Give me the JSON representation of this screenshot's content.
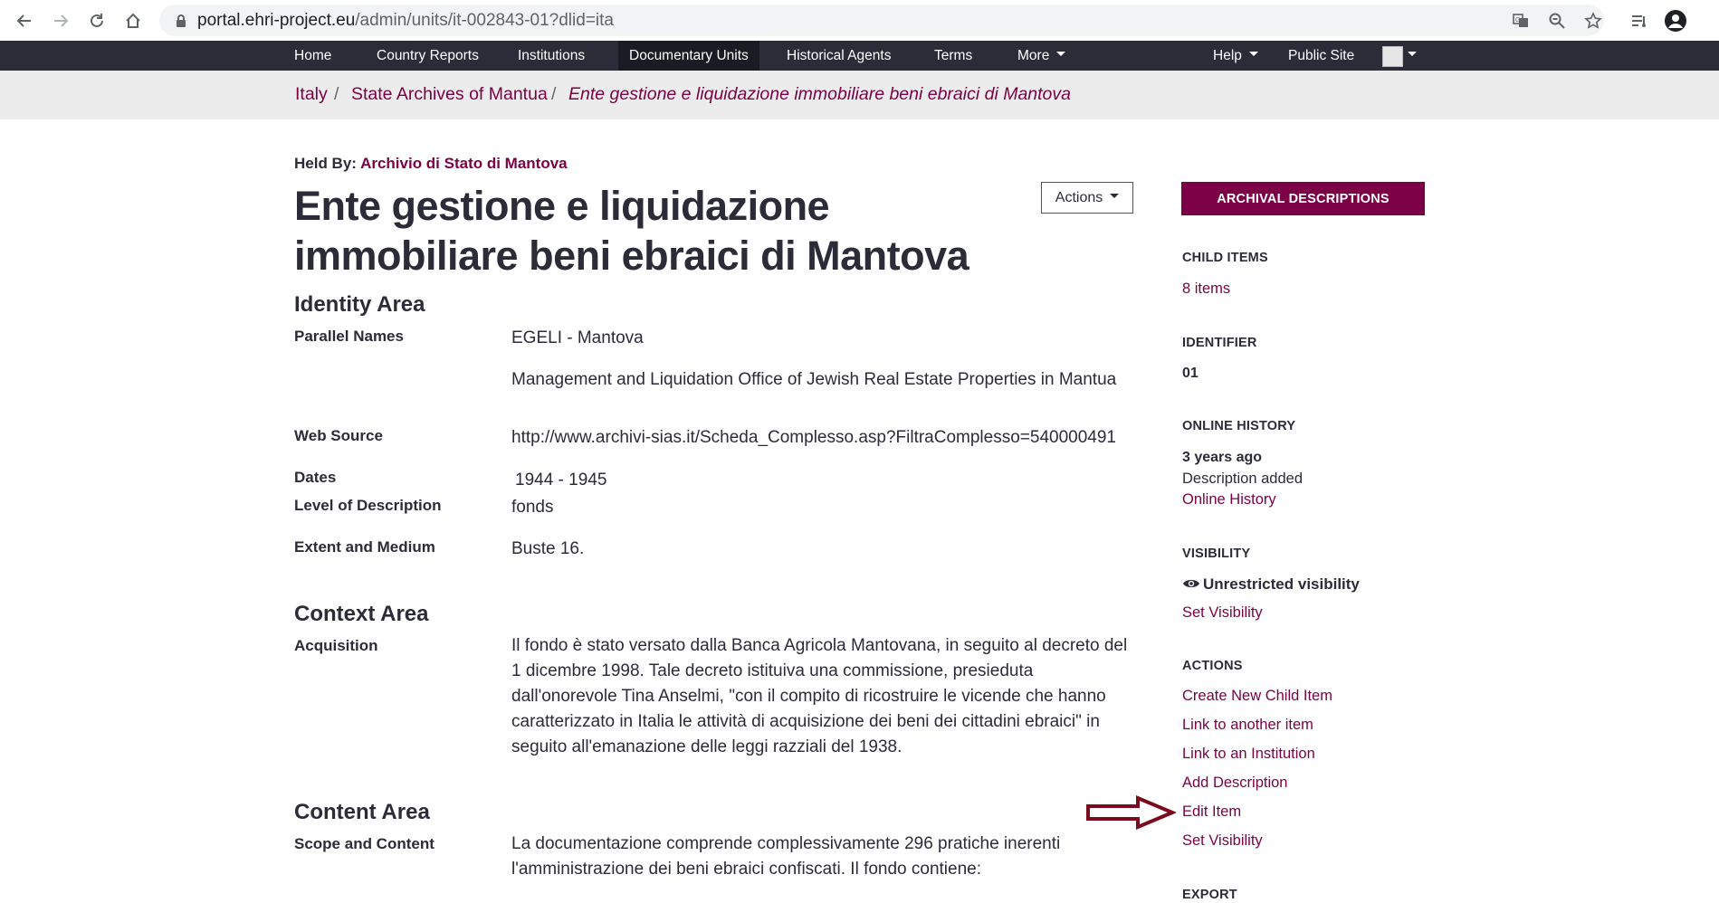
{
  "browser": {
    "url_host": "portal.ehri-project.eu",
    "url_path": "/admin/units/it-002843-01?dlid=ita"
  },
  "nav": {
    "items": [
      {
        "label": "Home"
      },
      {
        "label": "Country Reports"
      },
      {
        "label": "Institutions"
      },
      {
        "label": "Documentary Units"
      },
      {
        "label": "Historical Agents"
      },
      {
        "label": "Terms"
      },
      {
        "label": "More"
      }
    ],
    "help": "Help",
    "public_site": "Public Site"
  },
  "breadcrumb": {
    "items": [
      "Italy",
      "State Archives of Mantua"
    ],
    "current": "Ente gestione e liquidazione immobiliare beni ebraici di Mantova",
    "separator": "/"
  },
  "main": {
    "held_by_label": "Held By:",
    "held_by_value": "Archivio di Stato di Mantova",
    "title": "Ente gestione e liquidazione immobiliare beni ebraici di Mantova",
    "actions_label": "Actions",
    "identity_heading": "Identity Area",
    "fields": {
      "parallel_names_label": "Parallel Names",
      "parallel_names_1": "EGELI - Mantova",
      "parallel_names_2": "Management and Liquidation Office of Jewish Real Estate Properties in Mantua",
      "web_source_label": "Web Source",
      "web_source_value": "http://www.archivi-sias.it/Scheda_Complesso.asp?FiltraComplesso=540000491",
      "dates_label": "Dates",
      "dates_value": "1944 - 1945",
      "level_label": "Level of Description",
      "level_value": "fonds",
      "extent_label": "Extent and Medium",
      "extent_value": "Buste 16."
    },
    "context_heading": "Context Area",
    "acquisition_label": "Acquisition",
    "acquisition_lines": [
      "Il fondo è stato versato dalla Banca Agricola Mantovana, in seguito al decreto del",
      "1 dicembre 1998. Tale decreto istituiva una commissione, presieduta",
      "dall'onorevole Tina Anselmi, \"con il compito di ricostruire le vicende che hanno",
      "caratterizzato in Italia le attività di acquisizione dei beni dei cittadini ebraici\" in",
      "seguito all'emanazione delle leggi razziali del 1938."
    ],
    "content_heading": "Content Area",
    "scope_label": "Scope and Content",
    "scope_lines": [
      "La documentazione comprende complessivamente 296 pratiche inerenti",
      "l'amministrazione dei beni ebraici confiscati. Il fondo contiene:"
    ]
  },
  "sidebar": {
    "archival_button": "ARCHIVAL DESCRIPTIONS",
    "child_items_heading": "CHILD ITEMS",
    "child_items_link": "8 items",
    "identifier_heading": "IDENTIFIER",
    "identifier_value": "01",
    "history_heading": "ONLINE HISTORY",
    "history_time": "3 years ago",
    "history_event": "Description added",
    "history_link": "Online History",
    "visibility_heading": "VISIBILITY",
    "visibility_value": "Unrestricted visibility",
    "set_visibility": "Set Visibility",
    "actions_heading": "ACTIONS",
    "actions": [
      "Create New Child Item",
      "Link to another item",
      "Link to an Institution",
      "Add Description",
      "Edit Item",
      "Set Visibility"
    ],
    "export_heading": "EXPORT"
  },
  "colors": {
    "brand": "#7b0045",
    "navbar": "#2c2c38",
    "arrow": "#7b0a1e"
  }
}
